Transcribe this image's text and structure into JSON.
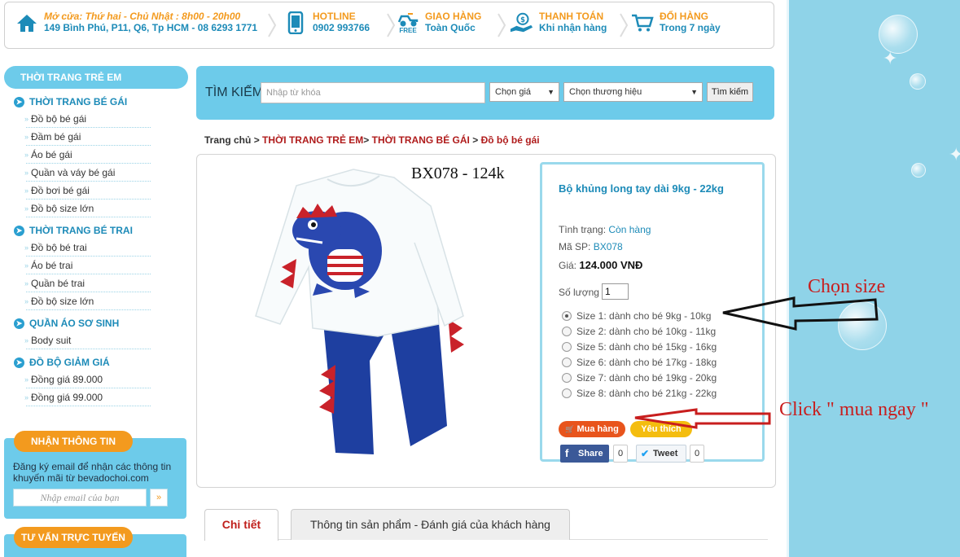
{
  "topbar": {
    "store": {
      "title": "Mở cửa: Thứ hai - Chủ Nhật : 8h00 - 20h00",
      "sub": "149 Bình Phú, P11, Q6, Tp HCM - 08 6293 1771"
    },
    "hotline": {
      "title": "HOTLINE",
      "sub": "0902 993766"
    },
    "shipping": {
      "title": "GIAO HÀNG",
      "sub": "Toàn Quốc",
      "badge": "FREE"
    },
    "payment": {
      "title": "THANH TOÁN",
      "sub": "Khi nhận hàng"
    },
    "exchange": {
      "title": "ĐỔI HÀNG",
      "sub": "Trong 7 ngày"
    }
  },
  "sidebar": {
    "heading": "THỜI TRANG TRẺ EM",
    "categories": [
      {
        "title": "THỜI TRANG BÉ GÁI",
        "items": [
          "Đồ bộ bé gái",
          "Đầm bé gái",
          "Áo bé gái",
          "Quần và váy bé gái",
          "Đồ bơi bé gái",
          "Đồ bộ size lớn"
        ]
      },
      {
        "title": "THỜI TRANG BÉ TRAI",
        "items": [
          "Đồ bộ bé trai",
          "Áo bé trai",
          "Quần bé trai",
          "Đồ bộ size lớn"
        ]
      },
      {
        "title": "QUẦN ÁO SƠ SINH",
        "items": [
          "Body suit"
        ]
      },
      {
        "title": "ĐỒ BỘ GIẢM GIÁ",
        "items": [
          "Đồng giá 89.000",
          "Đồng giá 99.000"
        ]
      }
    ],
    "newsletter": {
      "title": "NHẬN THÔNG TIN",
      "text": "Đăng ký email để nhận các thông tin khuyến mãi từ bevadochoi.com",
      "placeholder": "Nhập email của bạn",
      "go": "»"
    },
    "consult": {
      "title": "TƯ VẤN TRỰC TUYẾN"
    }
  },
  "search": {
    "label": "TÌM KIẾM",
    "placeholder": "Nhập từ khóa",
    "price_select": "Chọn giá",
    "brand_select": "Chọn thương hiệu",
    "button": "Tìm kiếm"
  },
  "breadcrumb": {
    "home": "Trang chủ",
    "sep": ">",
    "c1": "THỜI TRANG TRẺ EM",
    "c2": "THỜI TRANG BÉ GÁI",
    "c3": "Đồ bộ bé gái"
  },
  "product": {
    "image_caption": "BX078 - 124k",
    "name": "Bộ khủng long tay dài 9kg - 22kg",
    "status_label": "Tình trạng:",
    "status_value": "Còn hàng",
    "sku_label": "Mã SP:",
    "sku_value": "BX078",
    "price_label": "Giá:",
    "price_value": "124.000 VNĐ",
    "qty_label": "Số lượng",
    "qty_value": "1",
    "sizes": [
      "Size 1: dành cho bé 9kg - 10kg",
      "Size 2: dành cho bé 10kg - 11kg",
      "Size 5: dành cho bé 15kg - 16kg",
      "Size 6: dành cho bé 17kg - 18kg",
      "Size 7: dành cho bé 19kg - 20kg",
      "Size 8: dành cho bé 21kg - 22kg"
    ],
    "buy_label": "Mua hàng",
    "fav_label": "Yêu thích",
    "share_label": "Share",
    "share_count": "0",
    "tweet_label": "Tweet",
    "tweet_count": "0"
  },
  "tabs": [
    "Chi tiết",
    "Thông tin sản phẩm - Đánh giá của khách hàng"
  ],
  "annotations": {
    "size_note": "Chọn size",
    "buy_note": "Click \" mua ngay \""
  },
  "colors": {
    "accent": "#6dcbea",
    "orange": "#f39a1e",
    "link": "#1d8bb8",
    "red": "#c81e1e"
  }
}
